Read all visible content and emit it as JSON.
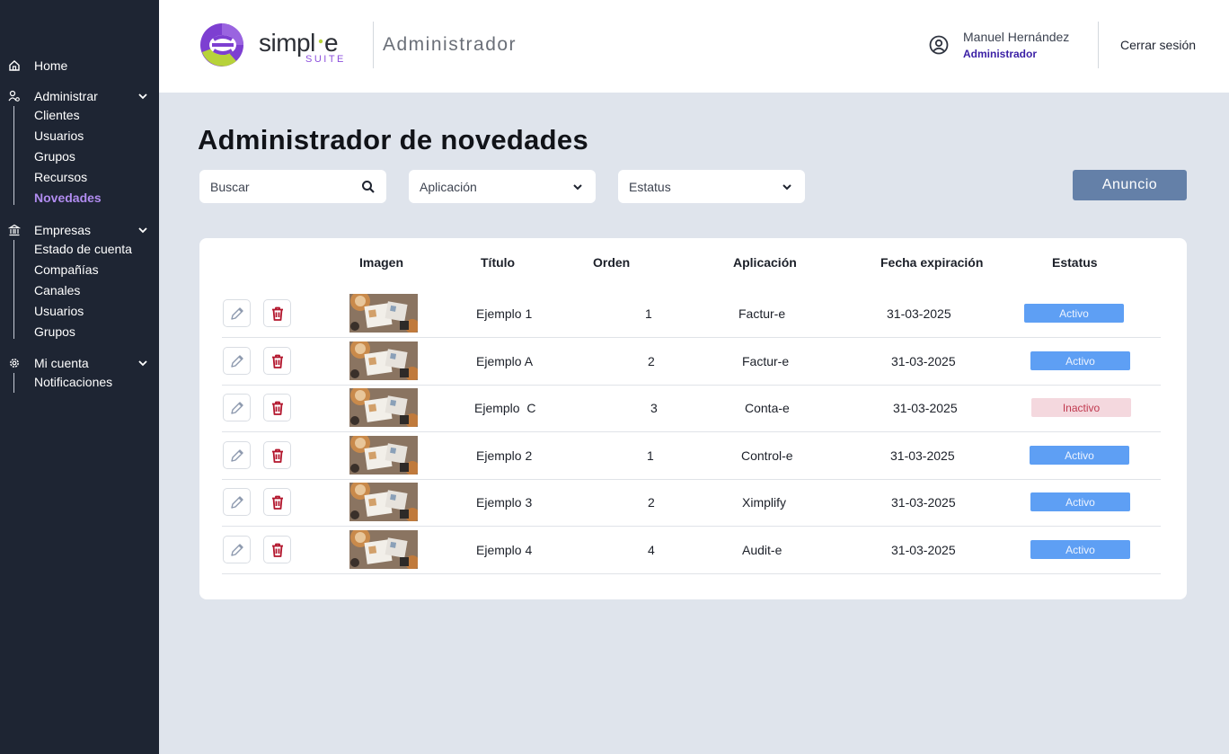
{
  "sidebar": {
    "home": "Home",
    "administrar": {
      "label": "Administrar",
      "items": [
        "Clientes",
        "Usuarios",
        "Grupos",
        "Recursos",
        "Novedades"
      ]
    },
    "empresas": {
      "label": "Empresas",
      "items": [
        "Estado de cuenta",
        "Compañías",
        "Canales",
        "Usuarios",
        "Grupos"
      ]
    },
    "mi_cuenta": {
      "label": "Mi cuenta",
      "items": [
        "Notificaciones"
      ]
    },
    "active_item": "Novedades"
  },
  "header": {
    "logo_text": "simpl·e",
    "logo_sub": "SUITE",
    "section": "Administrador",
    "user_name": "Manuel Hernández",
    "user_role": "Administrador",
    "logout": "Cerrar sesión"
  },
  "main": {
    "title": "Administrador de novedades",
    "search_placeholder": "Buscar",
    "app_select": "Aplicación",
    "status_select": "Estatus",
    "new_button": "Anuncio"
  },
  "table": {
    "headers": {
      "imagen": "Imagen",
      "titulo": "Título",
      "orden": "Orden",
      "aplicacion": "Aplicación",
      "fecha": "Fecha expiración",
      "estatus": "Estatus"
    },
    "rows": [
      {
        "titulo": "Ejemplo 1",
        "orden": "1",
        "aplicacion": "Factur-e",
        "fecha": "31-03-2025",
        "estatus": "Activo",
        "active": true
      },
      {
        "titulo": "Ejemplo A",
        "orden": "2",
        "aplicacion": "Factur-e",
        "fecha": "31-03-2025",
        "estatus": "Activo",
        "active": true
      },
      {
        "titulo": "Ejemplo  C",
        "orden": "3",
        "aplicacion": "Conta-e",
        "fecha": "31-03-2025",
        "estatus": "Inactivo",
        "active": false
      },
      {
        "titulo": "Ejemplo 2",
        "orden": "1",
        "aplicacion": "Control-e",
        "fecha": "31-03-2025",
        "estatus": "Activo",
        "active": true
      },
      {
        "titulo": "Ejemplo 3",
        "orden": "2",
        "aplicacion": "Ximplify",
        "fecha": "31-03-2025",
        "estatus": "Activo",
        "active": true
      },
      {
        "titulo": "Ejemplo 4",
        "orden": "4",
        "aplicacion": "Audit-e",
        "fecha": "31-03-2025",
        "estatus": "Activo",
        "active": true
      }
    ]
  },
  "colors": {
    "sidebar_bg": "#1e2533",
    "accent_active": "#b18cf0",
    "badge_active": "#5e9ff4",
    "badge_inactive": "#f4d8de",
    "button": "#6480a8",
    "delete_icon": "#b3162d"
  },
  "icons": {
    "home": "home-icon",
    "admin": "admin-icon",
    "empresas": "building-icon",
    "cuenta": "gear-icon",
    "user": "user-circle-icon",
    "search": "search-icon",
    "edit": "pencil-icon",
    "delete": "trash-icon"
  }
}
